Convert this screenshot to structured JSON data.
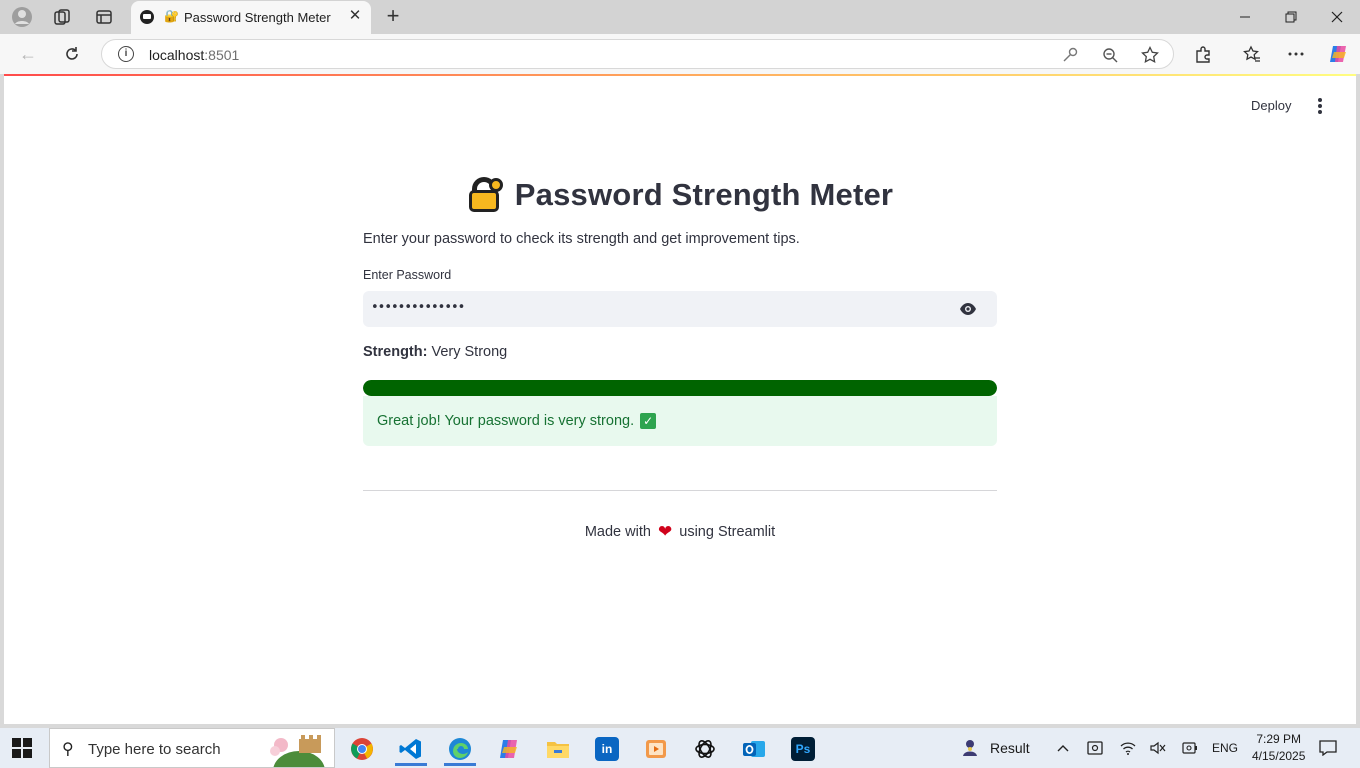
{
  "browser": {
    "tab_title": "Password Strength Meter",
    "tab_emoji": "🔐",
    "url_host": "localhost",
    "url_port": ":8501"
  },
  "app": {
    "deploy_label": "Deploy",
    "title": "Password Strength Meter",
    "description": "Enter your password to check its strength and get improvement tips.",
    "password_label": "Enter Password",
    "password_masked": "••••••••••••••",
    "strength_label": "Strength:",
    "strength_value": "Very Strong",
    "strength_progress": 1.0,
    "success_message": "Great job! Your password is very strong.",
    "footer_prefix": "Made with",
    "footer_suffix": "using Streamlit",
    "colors": {
      "progress_fill": "#006400",
      "alert_bg": "#e8f9ee",
      "alert_text": "#177233",
      "text": "#31333f"
    }
  },
  "taskbar": {
    "search_placeholder": "Type here to search",
    "weather_label": "Result",
    "language": "ENG",
    "time": "7:29 PM",
    "date": "4/15/2025"
  }
}
